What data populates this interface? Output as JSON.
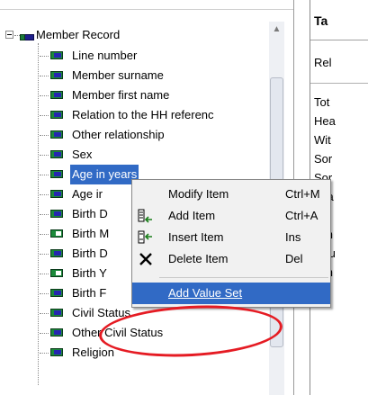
{
  "tree": {
    "record_label": "Member Record",
    "items": [
      {
        "label": "Line number",
        "icon": "item-icon",
        "selected": false
      },
      {
        "label": "Member surname",
        "icon": "item-icon",
        "selected": false
      },
      {
        "label": "Member first name",
        "icon": "item-icon",
        "selected": false
      },
      {
        "label": "Relation to the HH referenc",
        "icon": "item-icon",
        "selected": false
      },
      {
        "label": "Other relationship",
        "icon": "item-icon",
        "selected": false
      },
      {
        "label": "Sex",
        "icon": "item-icon",
        "selected": false
      },
      {
        "label": "Age in years",
        "icon": "item-icon",
        "selected": true
      },
      {
        "label": "Age ir",
        "icon": "item-icon",
        "selected": false
      },
      {
        "label": "Birth D",
        "icon": "item-icon",
        "selected": false
      },
      {
        "label": "Birth M",
        "icon": "subitem-icon",
        "selected": false
      },
      {
        "label": "Birth D",
        "icon": "item-icon",
        "selected": false
      },
      {
        "label": "Birth Y",
        "icon": "subitem-icon",
        "selected": false
      },
      {
        "label": "Birth F",
        "icon": "item-icon",
        "selected": false
      },
      {
        "label": "Civil Status",
        "icon": "item-icon",
        "selected": false
      },
      {
        "label": "Other Civil Status",
        "icon": "item-icon",
        "selected": false
      },
      {
        "label": "Religion",
        "icon": "item-icon",
        "selected": false
      }
    ]
  },
  "right_pane": {
    "title": "Ta",
    "rel_text": "Rel",
    "rows": [
      "Tot",
      "Hea",
      "Wit",
      "Sor",
      "Sor",
      "Gra",
      "Fat",
      "Oth",
      "Hou",
      "Oth"
    ]
  },
  "context_menu": {
    "items": [
      {
        "label": "Modify Item",
        "shortcut": "Ctrl+M",
        "icon": "none"
      },
      {
        "label": "Add Item",
        "shortcut": "Ctrl+A",
        "icon": "add-item-icon"
      },
      {
        "label": "Insert Item",
        "shortcut": "Ins",
        "icon": "insert-item-icon"
      },
      {
        "label": "Delete Item",
        "shortcut": "Del",
        "icon": "delete-x-icon"
      },
      {
        "label": "Add Value Set",
        "shortcut": "",
        "icon": "none"
      }
    ]
  },
  "colors": {
    "selection": "#316ac5",
    "annotation_circle": "#e51b23"
  }
}
